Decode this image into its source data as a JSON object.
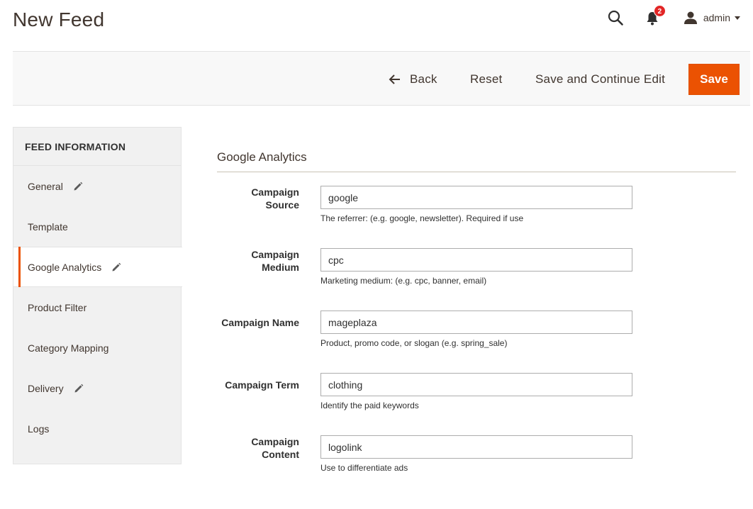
{
  "page": {
    "title": "New Feed"
  },
  "header": {
    "notifications_count": "2",
    "user_name": "admin"
  },
  "toolbar": {
    "back_label": "Back",
    "reset_label": "Reset",
    "save_continue_label": "Save and Continue Edit",
    "save_label": "Save"
  },
  "sidebar": {
    "heading": "FEED INFORMATION",
    "items": [
      {
        "label": "General",
        "edited": true
      },
      {
        "label": "Template",
        "edited": false
      },
      {
        "label": "Google Analytics",
        "edited": true,
        "active": true
      },
      {
        "label": "Product Filter",
        "edited": false
      },
      {
        "label": "Category Mapping",
        "edited": false
      },
      {
        "label": "Delivery",
        "edited": true
      },
      {
        "label": "Logs",
        "edited": false
      }
    ]
  },
  "section": {
    "title": "Google Analytics",
    "fields": [
      {
        "label_line1": "Campaign",
        "label_line2": "Source",
        "value": "google",
        "note": "The referrer: (e.g. google, newsletter). Required if use"
      },
      {
        "label_line1": "Campaign",
        "label_line2": "Medium",
        "value": "cpc",
        "note": "Marketing medium: (e.g. cpc, banner, email)"
      },
      {
        "label_line1": "Campaign Name",
        "label_line2": "",
        "value": "mageplaza",
        "note": "Product, promo code, or slogan (e.g. spring_sale)"
      },
      {
        "label_line1": "Campaign Term",
        "label_line2": "",
        "value": "clothing",
        "note": "Identify the paid keywords"
      },
      {
        "label_line1": "Campaign",
        "label_line2": "Content",
        "value": "logolink",
        "note": "Use to differentiate ads"
      }
    ]
  },
  "colors": {
    "accent": "#eb5202",
    "badge": "#e22626",
    "text": "#41362f"
  },
  "icons": {
    "search": "search-icon",
    "notifications": "bell-icon",
    "user": "user-icon",
    "back": "arrow-left-icon",
    "edited": "pencil-icon"
  }
}
